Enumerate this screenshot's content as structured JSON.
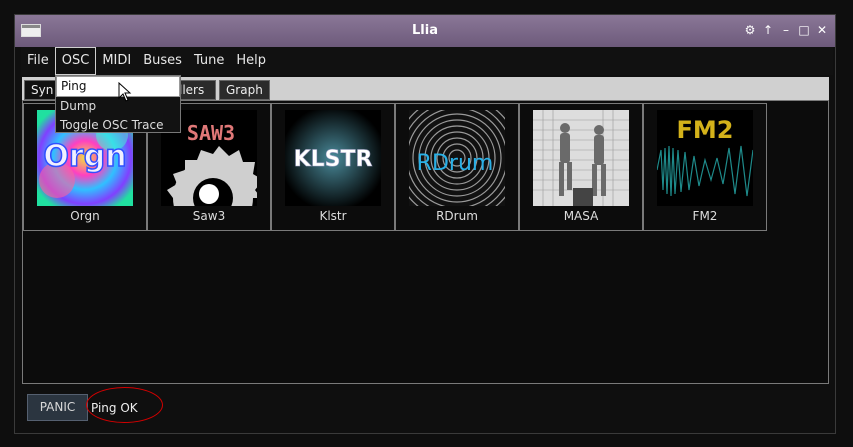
{
  "window": {
    "title": "Llia"
  },
  "menubar": {
    "items": [
      "File",
      "OSC",
      "MIDI",
      "Buses",
      "Tune",
      "Help"
    ]
  },
  "osc_menu": {
    "items": [
      "Ping",
      "Dump",
      "Toggle OSC Trace"
    ]
  },
  "tabs": {
    "synths": "Syn",
    "controllers": "llers",
    "graph": "Graph"
  },
  "synths": [
    {
      "label": "Orgn",
      "logo_text": "Orgn"
    },
    {
      "label": "Saw3",
      "logo_text": "SAW3"
    },
    {
      "label": "Klstr",
      "logo_text": "KLSTR"
    },
    {
      "label": "RDrum",
      "logo_text": "RDrum"
    },
    {
      "label": "MASA",
      "logo_text": ""
    },
    {
      "label": "FM2",
      "logo_text": "FM2"
    }
  ],
  "statusbar": {
    "panic_label": "PANIC",
    "status_text": "Ping OK"
  },
  "colors": {
    "titlebar": "#7d6a8c",
    "annotation": "#d40000",
    "rdrum_text": "#2ab0e6",
    "fm2_text": "#d4b21a",
    "saw3_text": "#e07878"
  }
}
